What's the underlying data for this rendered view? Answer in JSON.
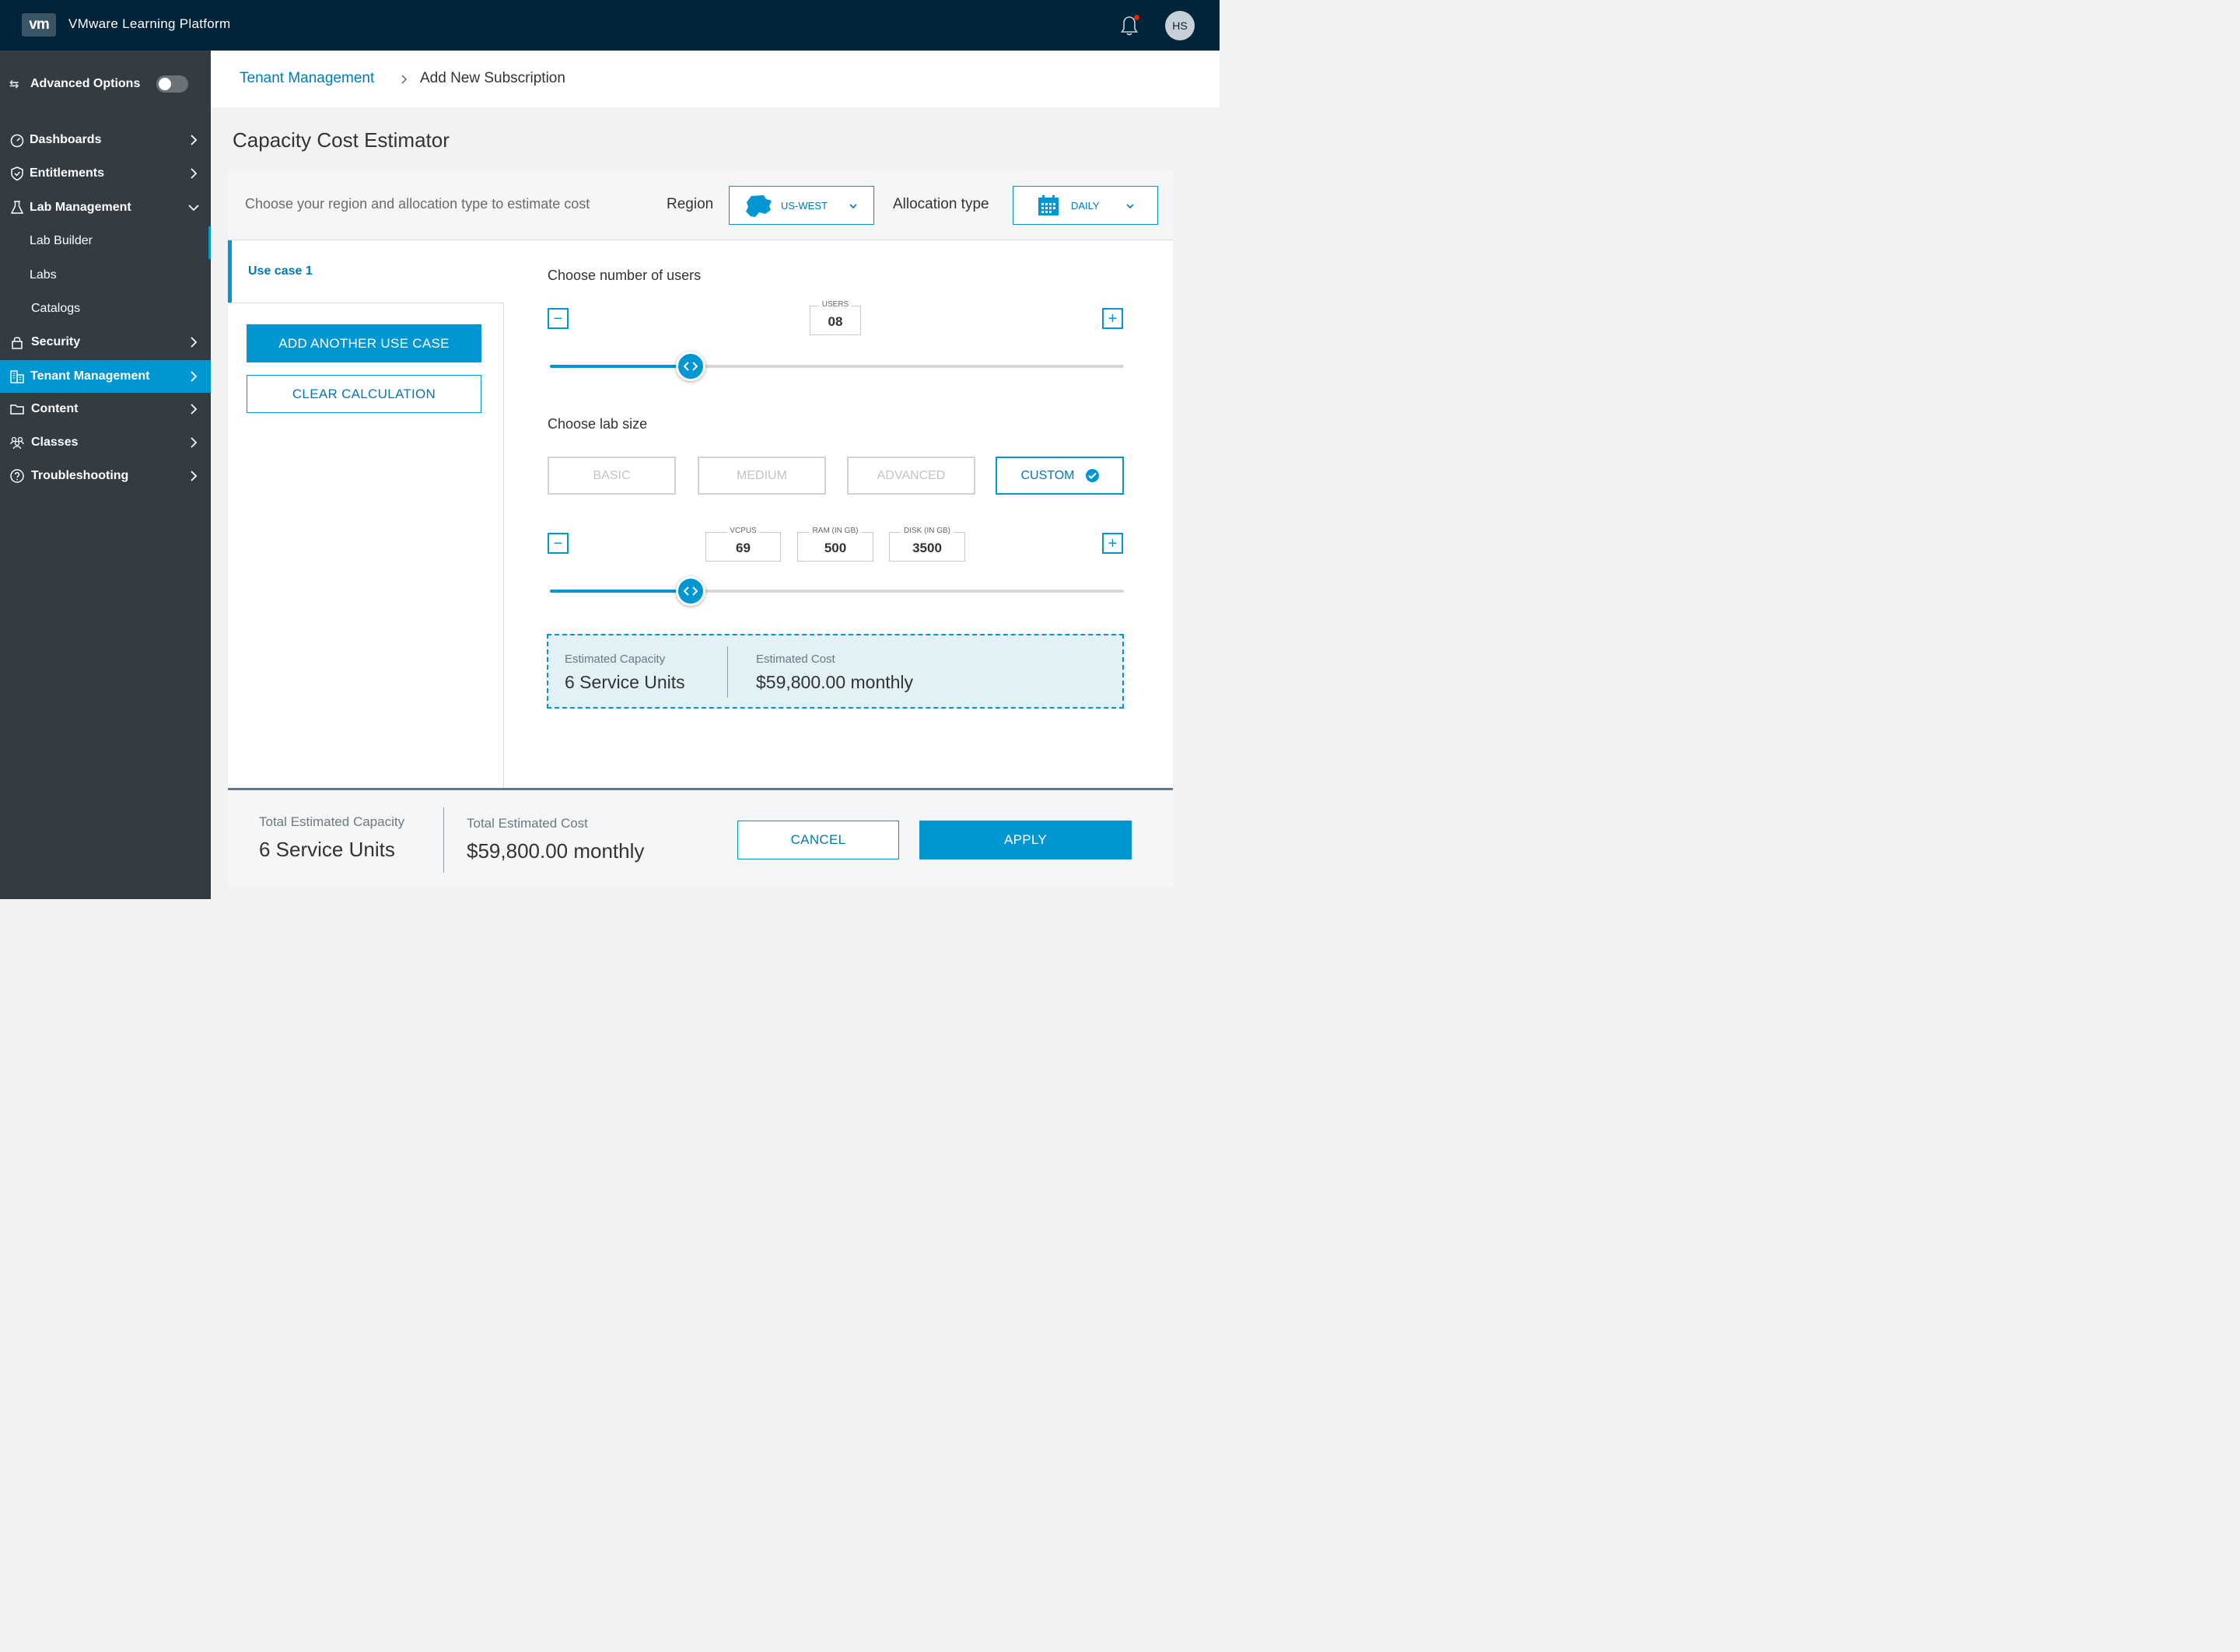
{
  "header": {
    "logo_text": "vm",
    "app_title": "VMware Learning Platform",
    "avatar_initials": "HS",
    "notification_indicator": true
  },
  "sidebar": {
    "advanced_options_label": "Advanced Options",
    "advanced_options_enabled": false,
    "items": [
      {
        "label": "Dashboards",
        "icon": "dashboard-icon",
        "expanded": false
      },
      {
        "label": "Entitlements",
        "icon": "shield-icon",
        "expanded": false
      },
      {
        "label": "Lab Management",
        "icon": "flask-icon",
        "expanded": true
      },
      {
        "label": "Security",
        "icon": "lock-icon",
        "expanded": false
      },
      {
        "label": "Tenant Management",
        "icon": "buildings-icon",
        "expanded": false,
        "active": true
      },
      {
        "label": "Content",
        "icon": "folder-icon",
        "expanded": false
      },
      {
        "label": "Classes",
        "icon": "users-icon",
        "expanded": false
      },
      {
        "label": "Troubleshooting",
        "icon": "help-circle-icon",
        "expanded": false
      }
    ],
    "lab_management_children": [
      "Lab Builder",
      "Labs",
      "Catalogs"
    ]
  },
  "breadcrumb": {
    "parent": "Tenant Management",
    "current": "Add New Subscription"
  },
  "page_title": "Capacity Cost Estimator",
  "estimator": {
    "instructions": "Choose your region and allocation type to estimate cost",
    "region_label": "Region",
    "region_value": "US-WEST",
    "allocation_label": "Allocation type",
    "allocation_value": "DAILY",
    "use_case_tab": "Use case 1",
    "add_use_case_button": "ADD ANOTHER USE CASE",
    "clear_button": "CLEAR CALCULATION",
    "users_section_label": "Choose number of users",
    "users_field_label": "USERS",
    "users_value": "08",
    "users_slider_fraction": 0.245,
    "lab_size_label": "Choose lab size",
    "lab_sizes": [
      "BASIC",
      "MEDIUM",
      "ADVANCED",
      "CUSTOM"
    ],
    "selected_lab_size": "CUSTOM",
    "vcpus_label": "VCPUS",
    "vcpus_value": "69",
    "ram_label": "RAM (IN GB)",
    "ram_value": "500",
    "disk_label": "DISK (IN GB)",
    "disk_value": "3500",
    "resources_slider_fraction": 0.245,
    "estimated_capacity_label": "Estimated Capacity",
    "estimated_capacity_value": "6 Service Units",
    "estimated_cost_label": "Estimated Cost",
    "estimated_cost_value": "$59,800.00 monthly"
  },
  "footer": {
    "total_capacity_label": "Total Estimated Capacity",
    "total_capacity_value": "6 Service Units",
    "total_cost_label": "Total Estimated Cost",
    "total_cost_value": "$59,800.00 monthly",
    "cancel_button": "CANCEL",
    "apply_button": "APPLY"
  },
  "colors": {
    "header_bg": "#00243a",
    "sidebar_bg": "#333c43",
    "accent": "#0095d3",
    "link": "#0079b8",
    "estimate_bg": "#e1f1f6"
  }
}
